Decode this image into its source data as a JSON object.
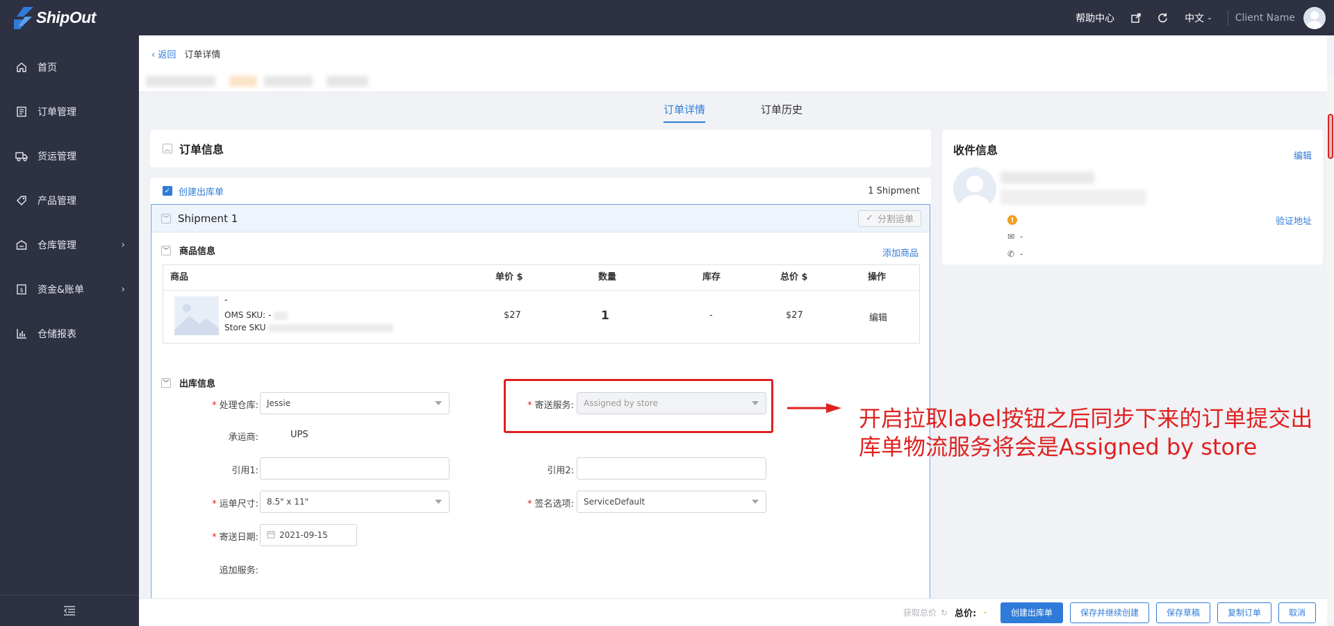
{
  "app": {
    "brand": "ShipOut"
  },
  "topbar": {
    "help": "帮助中心",
    "language": "中文",
    "client_name": "Client Name"
  },
  "sidebar": {
    "items": [
      {
        "label": "首页",
        "icon": "home-icon"
      },
      {
        "label": "订单管理",
        "icon": "order-icon"
      },
      {
        "label": "货运管理",
        "icon": "truck-icon"
      },
      {
        "label": "产品管理",
        "icon": "tag-icon"
      },
      {
        "label": "仓库管理",
        "icon": "warehouse-icon",
        "has_arrow": true
      },
      {
        "label": "资金&账单",
        "icon": "bill-icon",
        "has_arrow": true
      },
      {
        "label": "仓储报表",
        "icon": "report-icon"
      }
    ]
  },
  "breadcrumb": {
    "back": "返回",
    "current": "订单详情"
  },
  "tabs": [
    {
      "label": "订单详情",
      "active": true
    },
    {
      "label": "订单历史",
      "active": false
    }
  ],
  "order_info": {
    "title": "订单信息"
  },
  "outbound": {
    "create_label": "创建出库单",
    "shipment_count": "1 Shipment"
  },
  "shipment": {
    "title": "Shipment 1",
    "split_button": "分割运单",
    "product_section": "商品信息",
    "add_product": "添加商品",
    "table": {
      "headers": {
        "product": "商品",
        "unit_price": "单价 $",
        "qty": "数量",
        "stock": "库存",
        "total": "总价 $",
        "action": "操作"
      },
      "row": {
        "name": "-",
        "oms_sku": "OMS SKU: -",
        "store_sku": "Store SKU",
        "unit_price": "$27",
        "qty": "1",
        "stock": "-",
        "total": "$27",
        "action": "编辑"
      }
    },
    "outbound_section": "出库信息",
    "form": {
      "warehouse_label": "处理仓库:",
      "warehouse_value": "Jessie",
      "service_label": "寄送服务:",
      "service_value": "Assigned by store",
      "carrier_label": "承运商:",
      "carrier_value": "UPS",
      "ref1_label": "引用1:",
      "ref2_label": "引用2:",
      "size_label": "运单尺寸:",
      "size_value": "8.5\" x 11\"",
      "signature_label": "签名选项:",
      "signature_value": "ServiceDefault",
      "date_label": "寄送日期:",
      "date_value": "2021-09-15",
      "extra_label": "追加服务:"
    }
  },
  "receiver": {
    "title": "收件信息",
    "edit": "编辑",
    "verify": "验证地址",
    "email": "-",
    "phone": "-"
  },
  "annotation": {
    "text": "开启拉取label按钮之后同步下来的订单提交出库单物流服务将会是Assigned by store",
    "color": "#e02020"
  },
  "footer": {
    "get_total": "获取总价",
    "total_label": "总价:",
    "total_value": "-",
    "buttons": {
      "create": "创建出库单",
      "save_continue": "保存并继续创建",
      "save_draft": "保存草稿",
      "copy": "复制订单",
      "cancel": "取消"
    }
  },
  "colors": {
    "sidebar": "#2d3142",
    "accent": "#2f7bd9",
    "warning": "#f0a020"
  }
}
